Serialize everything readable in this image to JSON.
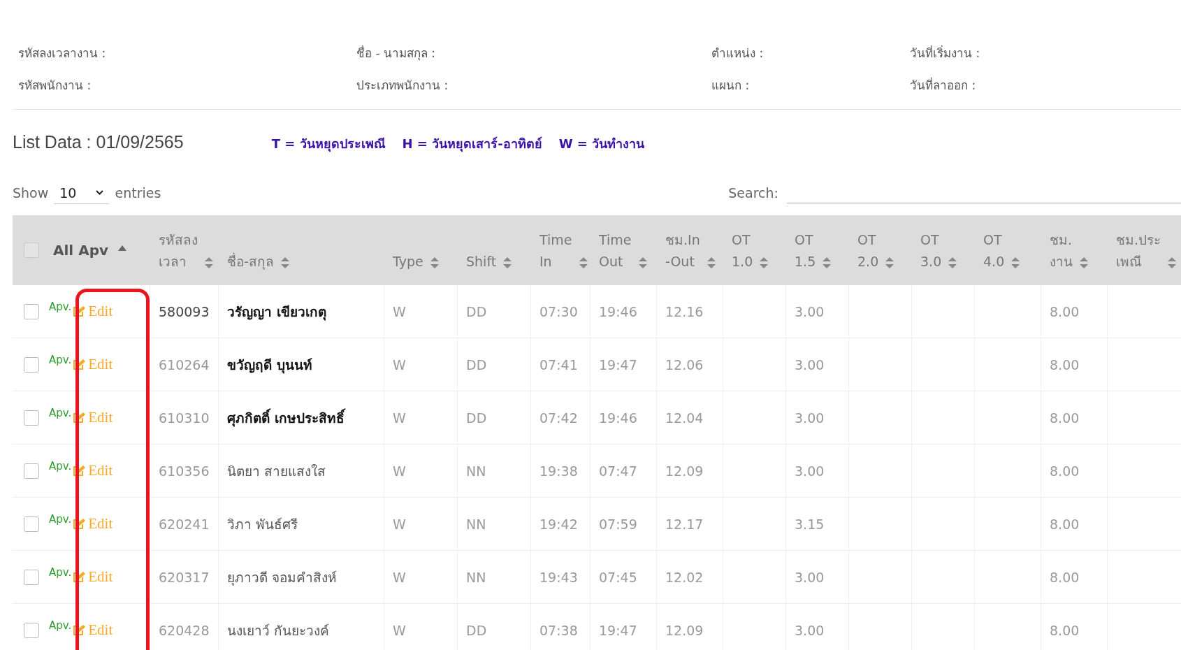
{
  "info": [
    {
      "label": "รหัสลงเวลางาน :"
    },
    {
      "label": "ชื่อ - นามสกุล :"
    },
    {
      "label": "ตำแหน่ง :"
    },
    {
      "label": "วันที่เริ่มงาน :"
    },
    {
      "label": "รหัสพนักงาน :"
    },
    {
      "label": "ประเภทพนักงาน :"
    },
    {
      "label": "แผนก :"
    },
    {
      "label": "วันที่ลาออก :"
    }
  ],
  "list_title": "List Data : 01/09/2565",
  "legend": [
    "T = วันหยุดประเพณี",
    "H = วันหยุดเสาร์-อาทิตย์",
    "W = วันทำงาน"
  ],
  "length": {
    "show": "Show",
    "value": "10",
    "entries": "entries"
  },
  "search": {
    "label": "Search:"
  },
  "columns": [
    {
      "lines": [
        "All Apv"
      ],
      "sorted": true,
      "checked": false
    },
    {
      "lines": [
        "รหัสลง",
        "เวลา"
      ],
      "sorted": false
    },
    {
      "lines": [
        "ชื่อ-สกุล"
      ],
      "sorted": false
    },
    {
      "lines": [
        "Type"
      ],
      "sorted": false
    },
    {
      "lines": [
        "Shift"
      ],
      "sorted": false
    },
    {
      "lines": [
        "Time",
        "In"
      ],
      "sorted": false
    },
    {
      "lines": [
        "Time",
        "Out"
      ],
      "sorted": false
    },
    {
      "lines": [
        "ชม.In",
        "-Out"
      ],
      "sorted": false
    },
    {
      "lines": [
        "OT",
        "1.0"
      ],
      "sorted": false
    },
    {
      "lines": [
        "OT",
        "1.5"
      ],
      "sorted": false
    },
    {
      "lines": [
        "OT",
        "2.0"
      ],
      "sorted": false
    },
    {
      "lines": [
        "OT",
        "3.0"
      ],
      "sorted": false
    },
    {
      "lines": [
        "OT",
        "4.0"
      ],
      "sorted": false
    },
    {
      "lines": [
        "ชม.",
        "งาน"
      ],
      "sorted": false
    },
    {
      "lines": [
        "ชม.ประ",
        "เพณี"
      ],
      "sorted": false
    }
  ],
  "edit_column_highlighted": true,
  "rows": [
    {
      "checked": false,
      "apv": "Apv.",
      "edit": "Edit",
      "active": true,
      "bold": true,
      "cells": [
        "580093",
        "วรัญญา เขียวเกตุ",
        "W",
        "DD",
        "07:30",
        "19:46",
        "12.16",
        null,
        "3.00",
        null,
        null,
        null,
        "8.00",
        null
      ]
    },
    {
      "checked": false,
      "apv": "Apv.",
      "edit": "Edit",
      "active": false,
      "bold": true,
      "cells": [
        "610264",
        "ขวัญฤดี บุนนท์",
        "W",
        "DD",
        "07:41",
        "19:47",
        "12.06",
        null,
        "3.00",
        null,
        null,
        null,
        "8.00",
        null
      ]
    },
    {
      "checked": false,
      "apv": "Apv.",
      "edit": "Edit",
      "active": false,
      "bold": true,
      "cells": [
        "610310",
        "ศุภกิตติ์ เกษประสิทธิ์",
        "W",
        "DD",
        "07:42",
        "19:46",
        "12.04",
        null,
        "3.00",
        null,
        null,
        null,
        "8.00",
        null
      ]
    },
    {
      "checked": false,
      "apv": "Apv.",
      "edit": "Edit",
      "active": false,
      "bold": false,
      "cells": [
        "610356",
        "นิตยา สายแสงใส",
        "W",
        "NN",
        "19:38",
        "07:47",
        "12.09",
        null,
        "3.00",
        null,
        null,
        null,
        "8.00",
        null
      ]
    },
    {
      "checked": false,
      "apv": "Apv.",
      "edit": "Edit",
      "active": false,
      "bold": false,
      "cells": [
        "620241",
        "วิภา พันธ์ศรี",
        "W",
        "NN",
        "19:42",
        "07:59",
        "12.17",
        null,
        "3.15",
        null,
        null,
        null,
        "8.00",
        null
      ]
    },
    {
      "checked": false,
      "apv": "Apv.",
      "edit": "Edit",
      "active": false,
      "bold": false,
      "cells": [
        "620317",
        "ยุภาวดี จอมคำสิงห์",
        "W",
        "NN",
        "19:43",
        "07:45",
        "12.02",
        null,
        "3.00",
        null,
        null,
        null,
        "8.00",
        null
      ]
    },
    {
      "checked": false,
      "apv": "Apv.",
      "edit": "Edit",
      "active": false,
      "bold": false,
      "cells": [
        "620428",
        "นงเยาว์ กันยะวงค์",
        "W",
        "DD",
        "07:38",
        "19:47",
        "12.09",
        null,
        "3.00",
        null,
        null,
        null,
        "8.00",
        null
      ]
    }
  ]
}
